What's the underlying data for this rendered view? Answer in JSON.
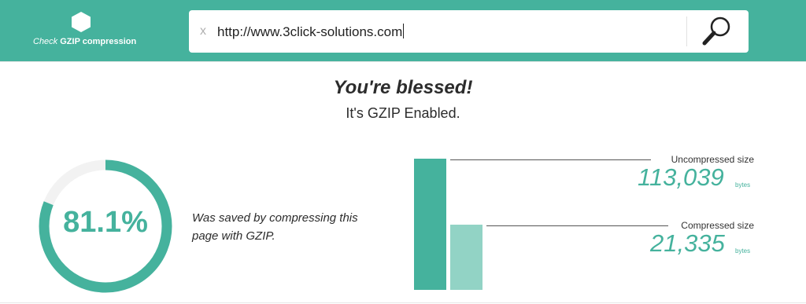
{
  "brand": {
    "logo_icon": "hexagon-icon",
    "title_prefix": "Check",
    "title_main": "GZIP compression"
  },
  "search": {
    "clear_label": "x",
    "url_value": "http://www.3click-solutions.com",
    "button_icon": "magnifier-icon"
  },
  "result": {
    "headline": "You're blessed!",
    "subline": "It's GZIP Enabled."
  },
  "stats": {
    "percent_saved": 81.1,
    "percent_label": "81.1%",
    "saved_description": "Was saved by compressing this page with GZIP.",
    "uncompressed": {
      "label": "Uncompressed size",
      "value": "113,039",
      "unit": "bytes",
      "bytes": 113039
    },
    "compressed": {
      "label": "Compressed size",
      "value": "21,335",
      "unit": "bytes",
      "bytes": 21335
    }
  },
  "colors": {
    "accent": "#45b29d",
    "accent_light": "#92d3c5",
    "track": "#f2f2f2"
  }
}
